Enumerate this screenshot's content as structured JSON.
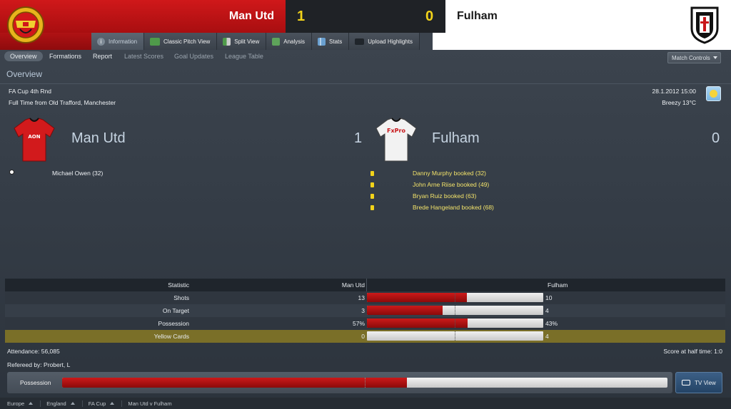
{
  "header": {
    "home_team": "Man Utd",
    "home_score": "1",
    "away_score": "0",
    "away_team": "Fulham",
    "colors": {
      "home": "#c8161a",
      "score_bg": "#1f2226",
      "score": "#f2d31a",
      "away": "#ffffff"
    }
  },
  "tabs": [
    {
      "label": "Information",
      "icon": "info-icon",
      "active": true
    },
    {
      "label": "Classic Pitch View",
      "icon": "pitch-icon"
    },
    {
      "label": "Split View",
      "icon": "split-view-icon"
    },
    {
      "label": "Analysis",
      "icon": "analysis-icon"
    },
    {
      "label": "Stats",
      "icon": "stats-icon"
    },
    {
      "label": "Upload Highlights",
      "icon": "camera-icon"
    }
  ],
  "subnav": {
    "items": [
      "Overview",
      "Formations",
      "Report",
      "Latest Scores",
      "Goal Updates",
      "League Table"
    ],
    "match_controls": "Match Controls"
  },
  "overview": {
    "title": "Overview",
    "competition": "FA Cup 4th Rnd",
    "venue": "Full Time from Old Trafford, Manchester",
    "datetime": "28.1.2012 15:00",
    "weather": "Breezy 13°C",
    "weather_icon": "sunny-icon"
  },
  "teams": {
    "home": {
      "name": "Man Utd",
      "score": "1",
      "shirt_sponsor": "AON"
    },
    "away": {
      "name": "Fulham",
      "score": "0",
      "shirt_sponsor": "FxPro"
    }
  },
  "events": {
    "home": [
      "Michael Owen (32)"
    ],
    "away": [
      "Danny Murphy booked (32)",
      "John Arne Riise booked (49)",
      "Bryan Ruiz booked (63)",
      "Brede Hangeland booked (68)"
    ]
  },
  "stats": {
    "header": {
      "label": "Statistic",
      "home": "Man Utd",
      "away": "Fulham"
    },
    "rows": [
      {
        "label": "Shots",
        "home": "13",
        "away": "10",
        "home_share": 0.565
      },
      {
        "label": "On Target",
        "home": "3",
        "away": "4",
        "home_share": 0.43
      },
      {
        "label": "Possession",
        "home": "57%",
        "away": "43%",
        "home_share": 0.57
      },
      {
        "label": "Yellow Cards",
        "home": "0",
        "away": "4",
        "home_share": 0.0
      }
    ]
  },
  "footer": {
    "attendance": "Attendance: 56,085",
    "halftime": "Score at half time: 1:0",
    "referee": "Refereed by: Probert, L",
    "possession_label": "Possession",
    "possession_home": 0.57,
    "tv_view": "TV View",
    "breadcrumbs": [
      "Europe",
      "England",
      "FA Cup",
      "Man Utd v Fulham"
    ]
  }
}
